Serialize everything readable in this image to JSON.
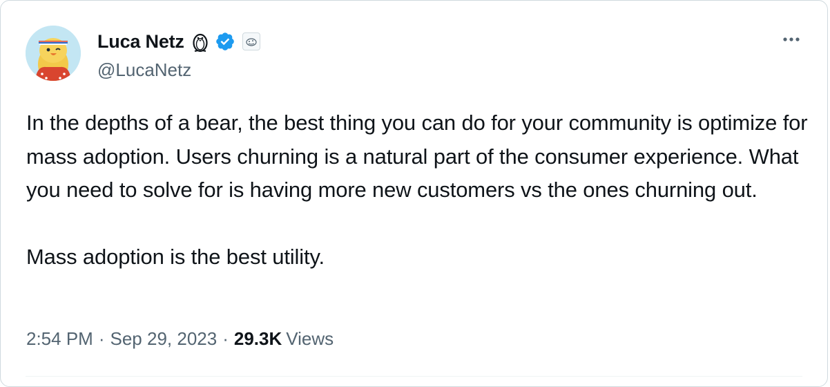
{
  "author": {
    "display_name": "Luca Netz",
    "handle": "@LucaNetz",
    "avatar_icon": "penguin-avatar",
    "badges": [
      "penguin-emoji-icon",
      "verified-badge-icon",
      "affiliate-badge-icon"
    ],
    "verified_color": "#1d9bf0"
  },
  "menu": {
    "more_icon": "more-options-icon"
  },
  "tweet": {
    "paragraphs": [
      "In the depths of a bear, the best thing you can do for your community is optimize for mass adoption. Users churning is a natural part of the consumer experience. What you need to solve for is having more new customers vs the ones churning out.",
      "Mass adoption is the best utility."
    ]
  },
  "meta": {
    "time": "2:54 PM",
    "separator": "·",
    "date": "Sep 29, 2023",
    "views_count": "29.3K",
    "views_label": "Views"
  },
  "colors": {
    "text_primary": "#0f1419",
    "text_secondary": "#536471",
    "border": "#cfd9de"
  }
}
